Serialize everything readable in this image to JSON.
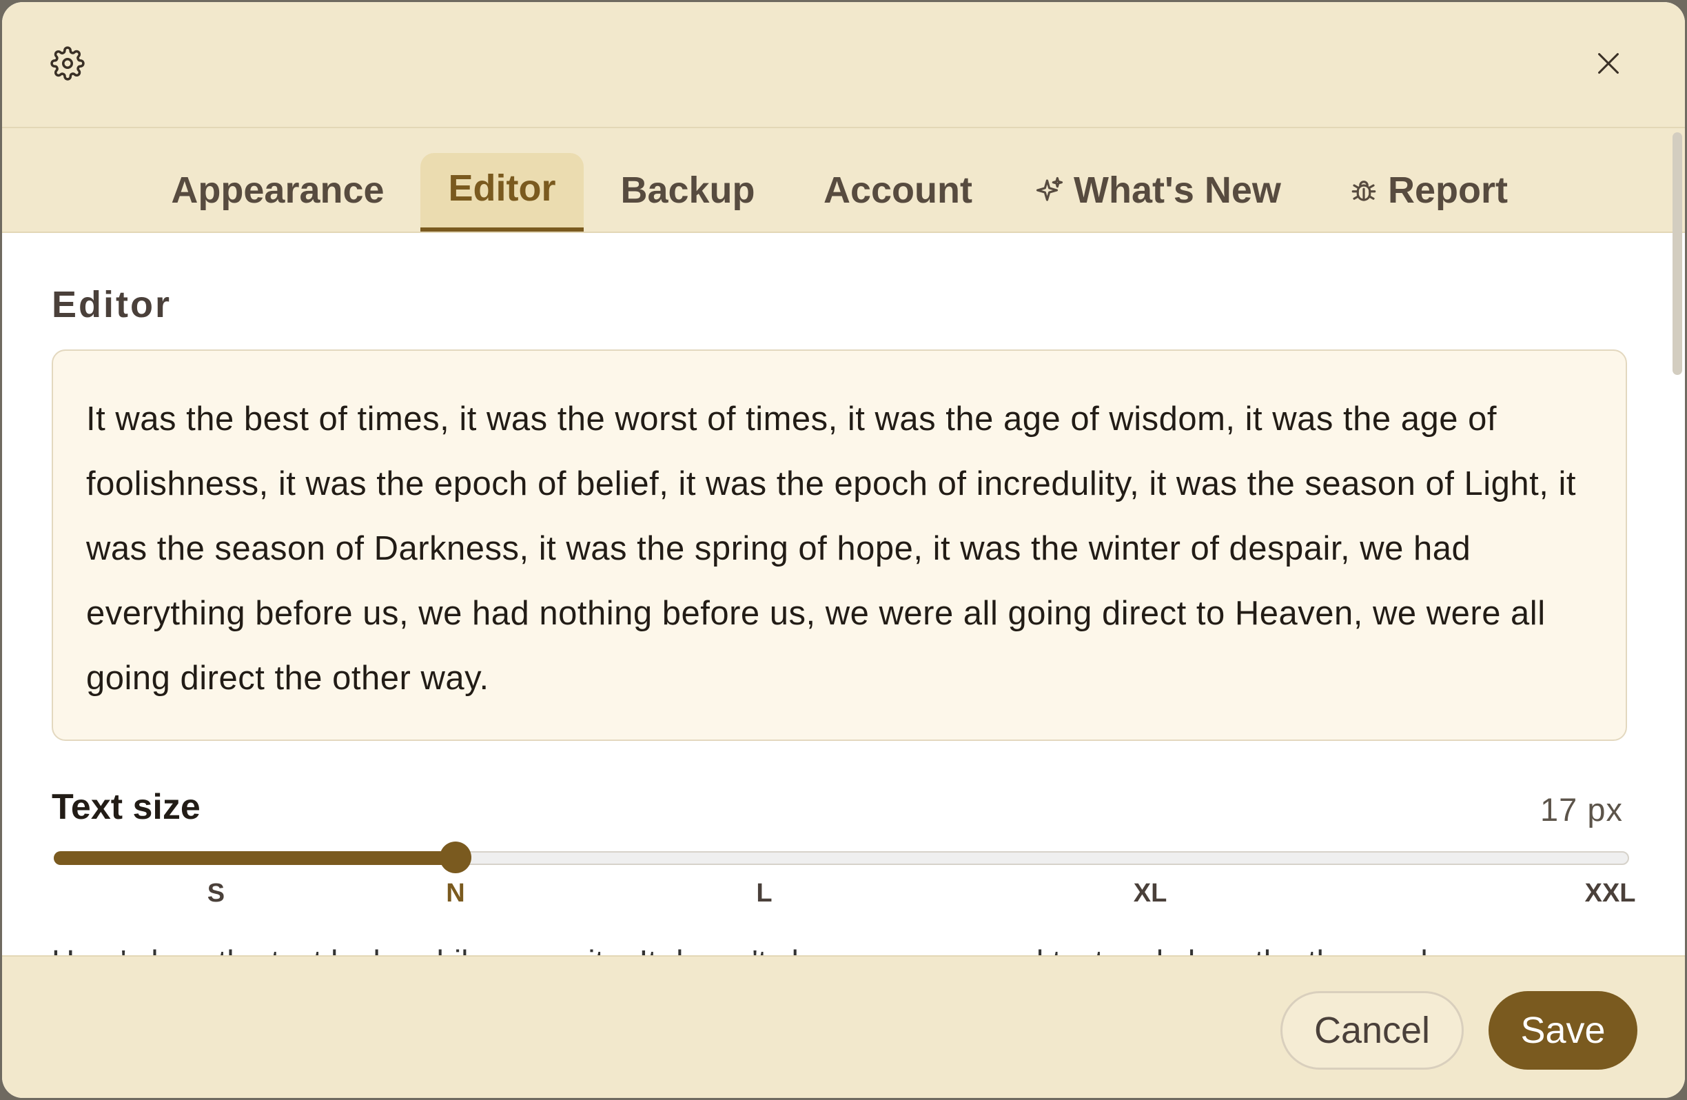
{
  "header": {
    "icon": "gear-icon",
    "close_icon": "close-icon"
  },
  "tabs": [
    {
      "label": "Appearance",
      "active": false
    },
    {
      "label": "Editor",
      "active": true
    },
    {
      "label": "Backup",
      "active": false
    },
    {
      "label": "Account",
      "active": false
    },
    {
      "label": "What's New",
      "icon": "sparkle-icon",
      "active": false
    },
    {
      "label": "Report",
      "icon": "bug-icon",
      "active": false
    }
  ],
  "editor": {
    "section_title": "Editor",
    "preview_text": "It was the best of times, it was the worst of times, it was the age of wisdom, it was the age of foolishness, it was the epoch of belief, it was the epoch of incredulity, it was the season of Light, it was the season of Darkness, it was the spring of hope, it was the winter of despair, we had everything before us, we had nothing before us, we were all going direct to Heaven, we were all going direct the other way.",
    "text_size": {
      "label": "Text size",
      "value_display": "17 px",
      "slider_level": 0.255,
      "ticks": [
        {
          "label": "S",
          "active": false
        },
        {
          "label": "N",
          "active": true
        },
        {
          "label": "L",
          "active": false
        },
        {
          "label": "XL",
          "active": false
        },
        {
          "label": "XXL",
          "active": false
        }
      ]
    },
    "next_hint_text": "Here's how the text looks while you write. It doesn't change your saved text, only how the theme shows"
  },
  "footer": {
    "cancel_label": "Cancel",
    "save_label": "Save"
  },
  "colors": {
    "accent": "#7a5a1f",
    "header_bg": "#f2e8cc",
    "preview_bg": "#fdf7ea"
  }
}
